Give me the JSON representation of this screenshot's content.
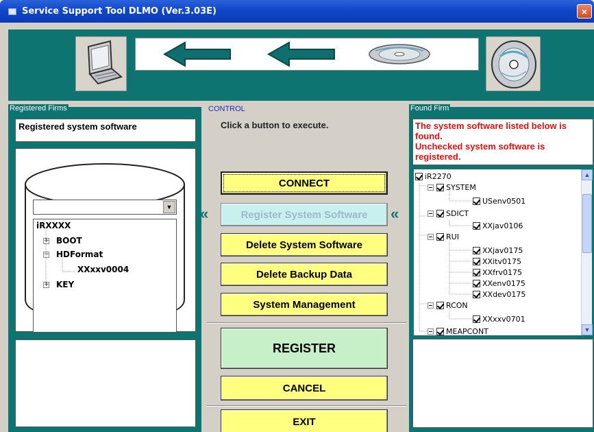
{
  "window": {
    "title": "Service Support Tool DLMO (Ver.3.03E)",
    "close_label": "×"
  },
  "registered": {
    "frame_title": "Registered Firms",
    "header_text": "Registered system software",
    "dropdown_value": "",
    "tree": {
      "root": "iRXXXX",
      "items": [
        {
          "label": "BOOT",
          "expander": "+"
        },
        {
          "label": "HDFormat",
          "expander": "−"
        },
        {
          "label": "XXxxv0004",
          "expander": ""
        },
        {
          "label": "KEY",
          "expander": "+"
        }
      ]
    }
  },
  "control": {
    "frame_title": "CONTROL",
    "hint": "Click a button to execute.",
    "buttons": {
      "connect": "CONNECT",
      "register_system_software": "Register System Software",
      "delete_system_software": "Delete System Software",
      "delete_backup_data": "Delete Backup Data",
      "system_management": "System Management",
      "register": "REGISTER",
      "cancel": "CANCEL",
      "exit": "EXIT"
    },
    "chevron": "«"
  },
  "found": {
    "frame_title": "Found Firm",
    "message_lines": [
      "The system software listed below is",
      "found.",
      "Unchecked system software is",
      "registered."
    ],
    "tree": [
      {
        "label": "iR2270",
        "level": 0,
        "expander": false
      },
      {
        "label": "SYSTEM",
        "level": 1,
        "expander": true
      },
      {
        "label": "USenv0501",
        "level": 2,
        "expander": false
      },
      {
        "label": "SDICT",
        "level": 1,
        "expander": true
      },
      {
        "label": "XXjav0106",
        "level": 2,
        "expander": false
      },
      {
        "label": "RUI",
        "level": 1,
        "expander": true
      },
      {
        "label": "XXjav0175",
        "level": 2,
        "expander": false
      },
      {
        "label": "XXitv0175",
        "level": 2,
        "expander": false
      },
      {
        "label": "XXfrv0175",
        "level": 2,
        "expander": false
      },
      {
        "label": "XXenv0175",
        "level": 2,
        "expander": false
      },
      {
        "label": "XXdev0175",
        "level": 2,
        "expander": false
      },
      {
        "label": "RCON",
        "level": 1,
        "expander": true
      },
      {
        "label": "XXxxv0701",
        "level": 2,
        "expander": false
      },
      {
        "label": "MEAPCONT",
        "level": 1,
        "expander": true
      }
    ]
  },
  "colors": {
    "teal": "#0e7471",
    "button_yellow": "#ffff80",
    "register_green": "#c8f0c8",
    "warning_red": "#e01010"
  }
}
